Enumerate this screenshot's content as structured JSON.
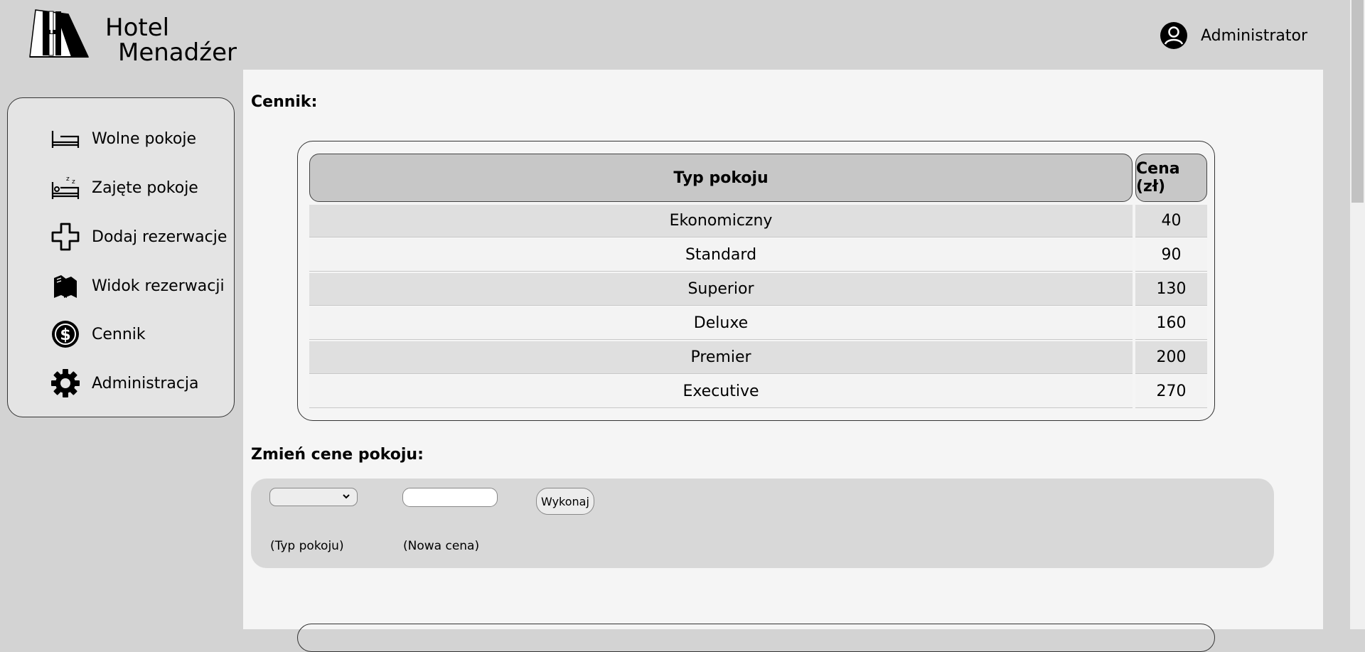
{
  "app": {
    "logo_line1": "Hotel",
    "logo_line2": "Menadźer",
    "user_name": "Administrator"
  },
  "sidebar": {
    "items": [
      {
        "label": "Wolne pokoje",
        "icon": "bed-icon"
      },
      {
        "label": "Zajęte pokoje",
        "icon": "sleeping-bed-icon"
      },
      {
        "label": "Dodaj rezerwacje",
        "icon": "plus-icon"
      },
      {
        "label": "Widok rezerwacji",
        "icon": "books-icon"
      },
      {
        "label": "Cennik",
        "icon": "dollar-icon"
      },
      {
        "label": "Administracja",
        "icon": "gear-icon"
      }
    ]
  },
  "pricing": {
    "title": "Cennik:",
    "headers": [
      "Typ pokoju",
      "Cena (zł)"
    ],
    "rows": [
      [
        "Ekonomiczny",
        "40"
      ],
      [
        "Standard",
        "90"
      ],
      [
        "Superior",
        "130"
      ],
      [
        "Deluxe",
        "160"
      ],
      [
        "Premier",
        "200"
      ],
      [
        "Executive",
        "270"
      ]
    ]
  },
  "change_price": {
    "title": "Zmień cene pokoju:",
    "select_value": "",
    "input_value": "",
    "button_label": "Wykonaj",
    "hint_type": "(Typ pokoju)",
    "hint_price": "(Nowa cena)"
  },
  "colors": {
    "background": "#d3d3d3",
    "main": "#f5f5f5",
    "header_cell": "#c7c7c7"
  }
}
